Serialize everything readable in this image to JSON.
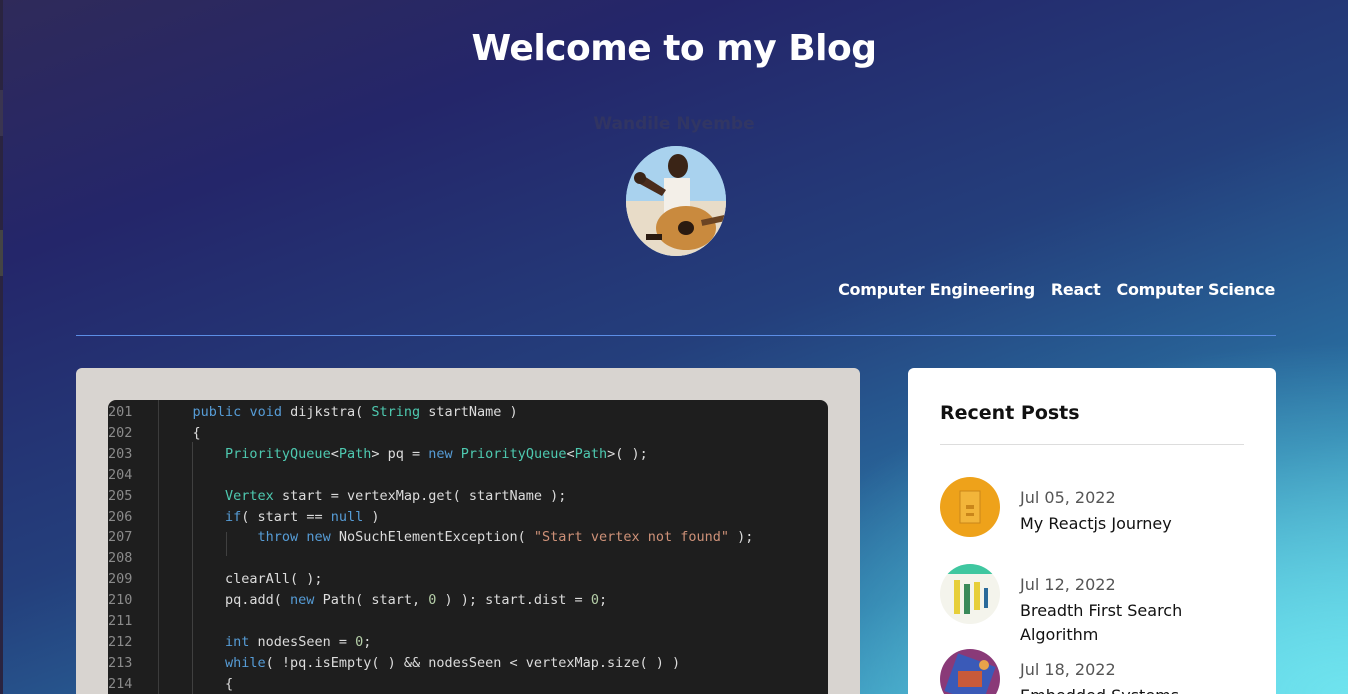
{
  "header": {
    "title": "Welcome to my Blog",
    "author_name": "Wandile Nyembe"
  },
  "nav": {
    "items": [
      "Computer Engineering",
      "React",
      "Computer Science"
    ]
  },
  "featured_post": {
    "code_lines": [
      {
        "num": "201",
        "html": "    <span class=\"kw\">public</span> <span class=\"kw\">void</span> dijkstra( <span class=\"ty\">String</span> startName )"
      },
      {
        "num": "202",
        "html": "    {"
      },
      {
        "num": "203",
        "html": "        <span class=\"ty\">PriorityQueue</span>&lt;<span class=\"ty\">Path</span>&gt; pq = <span class=\"kw\">new</span> <span class=\"ty\">PriorityQueue</span>&lt;<span class=\"ty\">Path</span>&gt;( );"
      },
      {
        "num": "204",
        "html": ""
      },
      {
        "num": "205",
        "html": "        <span class=\"ty\">Vertex</span> start = vertexMap.get( startName );"
      },
      {
        "num": "206",
        "html": "        <span class=\"kw\">if</span>( start == <span class=\"kw\">null</span> )"
      },
      {
        "num": "207",
        "html": "            <span class=\"kw\">throw</span> <span class=\"kw\">new</span> NoSuchElementException( <span class=\"str\">\"Start vertex not found\"</span> );"
      },
      {
        "num": "208",
        "html": ""
      },
      {
        "num": "209",
        "html": "        clearAll( );"
      },
      {
        "num": "210",
        "html": "        pq.add( <span class=\"kw\">new</span> Path( start, <span class=\"num\">0</span> ) ); start.dist = <span class=\"num\">0</span>;"
      },
      {
        "num": "211",
        "html": ""
      },
      {
        "num": "212",
        "html": "        <span class=\"kw\">int</span> nodesSeen = <span class=\"num\">0</span>;"
      },
      {
        "num": "213",
        "html": "        <span class=\"kw\">while</span>( !pq.isEmpty( ) &amp;&amp; nodesSeen &lt; vertexMap.size( ) )"
      },
      {
        "num": "214",
        "html": "        {"
      }
    ]
  },
  "recent_posts": {
    "title": "Recent Posts",
    "items": [
      {
        "date": "Jul 05, 2022",
        "title": "My Reactjs Journey"
      },
      {
        "date": "Jul 12, 2022",
        "title": "Breadth First Search Algorithm"
      },
      {
        "date": "Jul 18, 2022",
        "title": "Embedded Systems"
      }
    ]
  },
  "colors": {
    "accent_divider": "#5c8ee6",
    "keyword": "#569cd6",
    "type": "#4ec9b0",
    "string": "#ce9178",
    "number": "#b5cea8"
  }
}
